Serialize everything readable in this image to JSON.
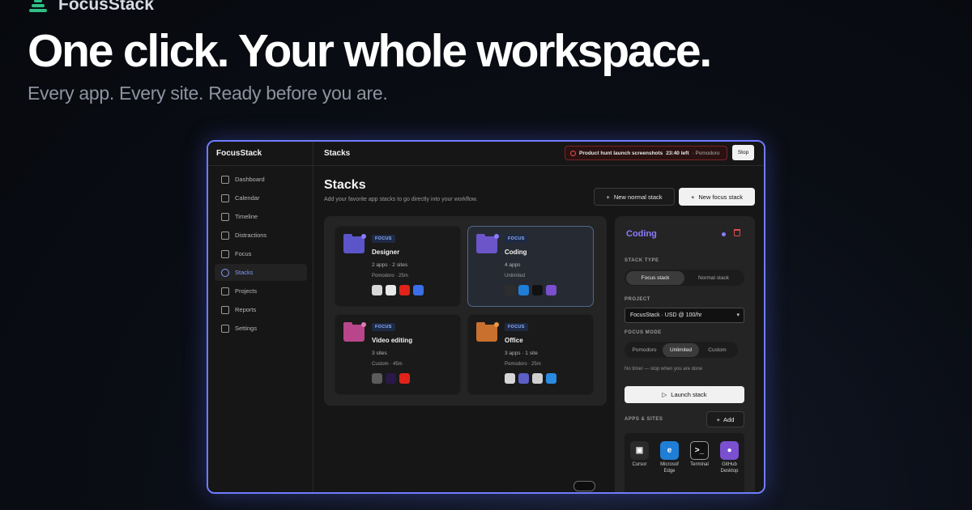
{
  "brand": {
    "name": "FocusStack",
    "logo_icon": "stack-icon"
  },
  "hero": {
    "title": "One click. Your whole workspace.",
    "subtitle": "Every app. Every site. Ready before you are."
  },
  "app": {
    "sidebar": {
      "title": "FocusStack",
      "items": [
        {
          "label": "Dashboard",
          "icon": "grid-icon"
        },
        {
          "label": "Calendar",
          "icon": "calendar-icon"
        },
        {
          "label": "Timeline",
          "icon": "clock-icon"
        },
        {
          "label": "Distractions",
          "icon": "bell-off-icon"
        },
        {
          "label": "Focus",
          "icon": "target-icon"
        },
        {
          "label": "Stacks",
          "icon": "stack-icon"
        },
        {
          "label": "Projects",
          "icon": "briefcase-icon"
        },
        {
          "label": "Reports",
          "icon": "bar-chart-icon"
        },
        {
          "label": "Settings",
          "icon": "gear-icon"
        }
      ],
      "active": "Stacks"
    },
    "topbar": {
      "title": "Stacks",
      "timer_task": "Product hunt launch screenshots",
      "timer_left": "23:40 left",
      "timer_mode": "· Pomodoro",
      "stop_label": "Stop"
    },
    "main": {
      "title": "Stacks",
      "subtitle": "Add your favorite app stacks to go directly into your workflow.",
      "new_normal_label": "New normal stack",
      "new_focus_label": "New focus stack"
    },
    "stacks": [
      {
        "badge": "FOCUS",
        "name": "Designer",
        "meta": "2 apps · 2 sites",
        "mode": "Pomodoro · 25m",
        "color": "#5b55c9",
        "dot": "#8b7cff",
        "icons": [
          "Figma",
          "Notion",
          "Adobe",
          "Canva"
        ]
      },
      {
        "badge": "FOCUS",
        "name": "Coding",
        "meta": "4 apps",
        "mode": "Unlimited",
        "color": "#6b55c9",
        "dot": "#8b7cff",
        "icons": [
          "Cursor",
          "Edge",
          "Terminal",
          "GitHub"
        ]
      },
      {
        "badge": "FOCUS",
        "name": "Video editing",
        "meta": "3 sites",
        "mode": "Custom · 45m",
        "color": "#b9468a",
        "dot": "#e07ab4",
        "icons": [
          "DaVinci",
          "Premiere",
          "Adobe"
        ]
      },
      {
        "badge": "FOCUS",
        "name": "Office",
        "meta": "3 apps · 1 site",
        "mode": "Pomodoro · 25m",
        "color": "#c9702e",
        "dot": "#e89a4b",
        "icons": [
          "Mail",
          "Teams",
          "Chrome",
          "Outlook"
        ]
      }
    ],
    "detail": {
      "title": "Coding",
      "stack_type_label": "STACK TYPE",
      "stack_types": [
        "Focus stack",
        "Normal stack"
      ],
      "stack_type_selected": "Focus stack",
      "project_label": "PROJECT",
      "project_value": "FocusStack · USD @ 100/hr",
      "focus_mode_label": "FOCUS MODE",
      "focus_modes": [
        "Pomodoro",
        "Unlimited",
        "Custom"
      ],
      "focus_mode_selected": "Unlimited",
      "note": "No timer — stop when you are done",
      "launch_label": "Launch stack",
      "apps_label": "APPS & SITES",
      "add_label": "Add",
      "apps": [
        {
          "name": "Cursor",
          "icon": "cube-icon",
          "color": "#2a2a2a"
        },
        {
          "name": "Microsof Edge",
          "icon": "edge-icon",
          "color": "#1f7ed6"
        },
        {
          "name": "Terminal",
          "icon": "terminal-icon",
          "color": "#111111"
        },
        {
          "name": "GitHub Desktop",
          "icon": "github-icon",
          "color": "#7a4fd0"
        }
      ]
    }
  }
}
